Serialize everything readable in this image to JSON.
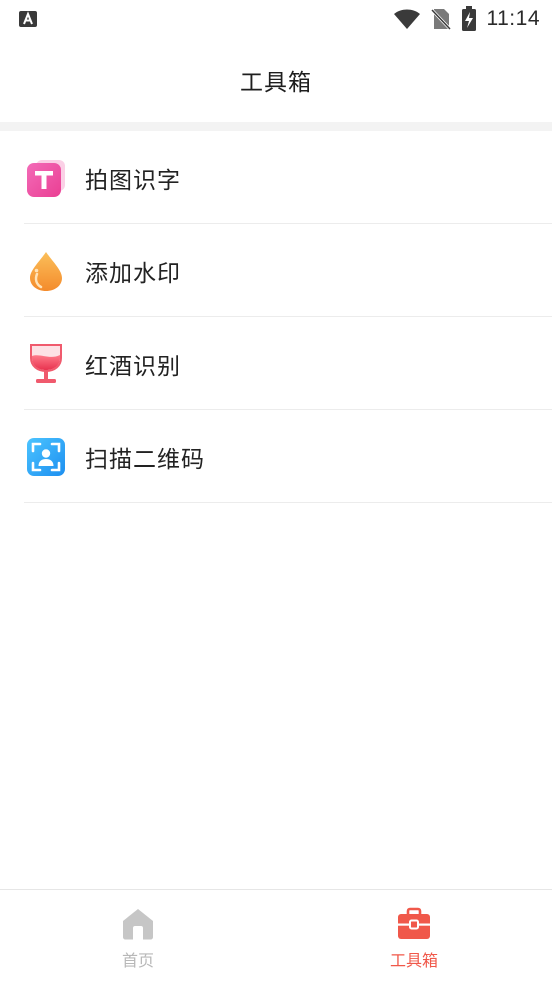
{
  "status_bar": {
    "time": "11:14",
    "icons": [
      "notification-a-icon",
      "wifi-icon",
      "no-sim-icon",
      "battery-charging-icon"
    ]
  },
  "header": {
    "title": "工具箱"
  },
  "tools": [
    {
      "label": "拍图识字",
      "icon": "text-recognition-icon"
    },
    {
      "label": "添加水印",
      "icon": "watermark-drop-icon"
    },
    {
      "label": "红酒识别",
      "icon": "wine-glass-icon"
    },
    {
      "label": "扫描二维码",
      "icon": "qr-scan-icon"
    }
  ],
  "bottom_nav": {
    "items": [
      {
        "label": "首页",
        "icon": "home-icon",
        "active": false
      },
      {
        "label": "工具箱",
        "icon": "toolbox-icon",
        "active": true
      }
    ]
  },
  "colors": {
    "accent": "#f0584a",
    "inactive": "#b8b8b8",
    "pink": "#f04ca3",
    "orange": "#f7a23a",
    "wine": "#f0445c",
    "blue": "#2aa8f2"
  }
}
